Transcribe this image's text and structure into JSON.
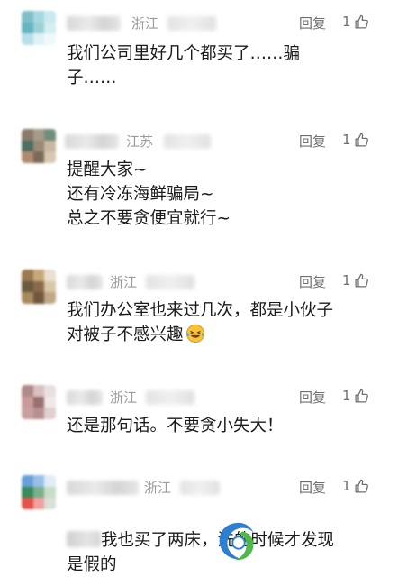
{
  "comments": [
    {
      "location": "浙江",
      "reply": "回复",
      "likes": "1",
      "text": "我们公司里好几个都买了……骗\n子……"
    },
    {
      "location": "江苏",
      "reply": "回复",
      "likes": "1",
      "text": "提醒大家~\n还有冷冻海鲜骗局~\n总之不要贪便宜就行~"
    },
    {
      "location": "浙江",
      "reply": "回复",
      "likes": "1",
      "text": "我们办公室也来过几次，都是小伙子\n对被子不感兴趣"
    },
    {
      "location": "浙江",
      "reply": "回复",
      "likes": "1",
      "text": "还是那句话。不要贪小失大！"
    },
    {
      "location": "浙江",
      "reply": "回复",
      "likes": "1",
      "text_line1": "我也买了两床，洗的时候才发现",
      "text_line2": "是假的"
    }
  ],
  "icons": {
    "like": "thumbs-up-icon",
    "emoji": "laughing-tears-emoji",
    "watermark": "swirl-logo"
  },
  "colors": {
    "secondary_text": "#9a9a9a",
    "action_text": "#6f6f6f",
    "watermark_blue": "#2f7fd0",
    "watermark_green": "#4fb84a"
  }
}
